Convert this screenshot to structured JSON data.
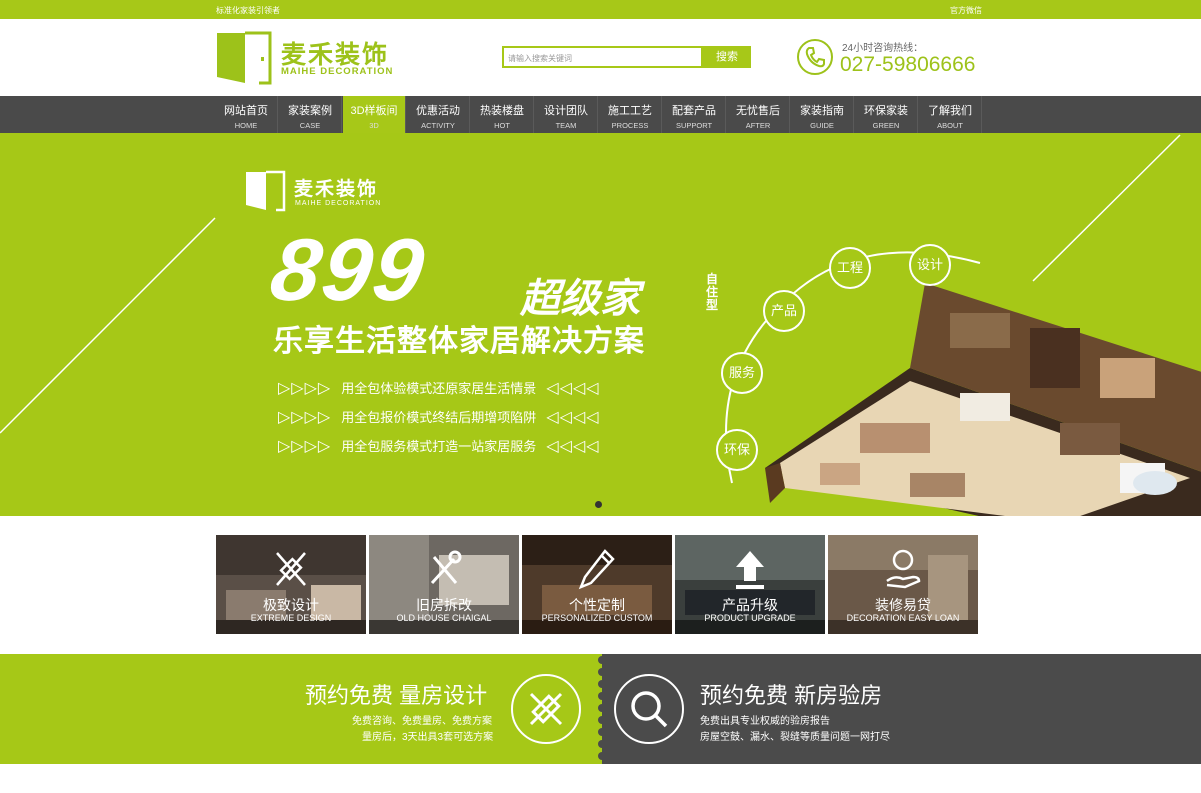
{
  "topbar": {
    "left": "标准化家装引领者",
    "right": "官方微信"
  },
  "header": {
    "logo_cn": "麦禾装饰",
    "logo_en": "MAIHE DECORATION",
    "search_placeholder": "请输入搜索关键词",
    "search_button": "搜索",
    "hotline_label": "24小时咨询热线：",
    "hotline_number": "027-59806666"
  },
  "nav": [
    {
      "cn": "网站首页",
      "en": "HOME"
    },
    {
      "cn": "家装案例",
      "en": "CASE"
    },
    {
      "cn": "3D样板间",
      "en": "3D"
    },
    {
      "cn": "优惠活动",
      "en": "ACTIVITY"
    },
    {
      "cn": "热装楼盘",
      "en": "HOT"
    },
    {
      "cn": "设计团队",
      "en": "TEAM"
    },
    {
      "cn": "施工工艺",
      "en": "PROCESS"
    },
    {
      "cn": "配套产品",
      "en": "SUPPORT"
    },
    {
      "cn": "无忧售后",
      "en": "AFTER"
    },
    {
      "cn": "家装指南",
      "en": "GUIDE"
    },
    {
      "cn": "环保家装",
      "en": "GREEN"
    },
    {
      "cn": "了解我们",
      "en": "ABOUT"
    }
  ],
  "banner": {
    "logo_cn": "麦禾装饰",
    "logo_en": "MAIHE DECORATION",
    "price": "899",
    "headline": "超级家",
    "side": "自住型",
    "subtitle": "乐享生活整体家居解决方案",
    "arrows_right": "▷▷▷▷",
    "arrows_left": "◁◁◁◁",
    "features": [
      "用全包体验模式还原家居生活情景",
      "用全包报价模式终结后期增项陷阱",
      "用全包服务模式打造一站家居服务"
    ],
    "tags": [
      "工程",
      "设计",
      "产品",
      "服务",
      "环保"
    ]
  },
  "services": [
    {
      "cn": "极致设计",
      "en": "EXTREME DESIGN",
      "icon": "pencil-ruler-icon"
    },
    {
      "cn": "旧房拆改",
      "en": "OLD HOUSE CHAIGAL",
      "icon": "tools-icon"
    },
    {
      "cn": "个性定制",
      "en": "PERSONALIZED CUSTOM",
      "icon": "pencil-icon"
    },
    {
      "cn": "产品升级",
      "en": "PRODUCT UPGRADE",
      "icon": "upload-icon"
    },
    {
      "cn": "装修易贷",
      "en": "DECORATION EASY LOAN",
      "icon": "yen-hand-icon"
    }
  ],
  "promo": {
    "left_title": "预约免费  量房设计",
    "left_line1": "免费咨询、免费量房、免费方案",
    "left_line2": "量房后，3天出具3套可选方案",
    "right_title": "预约免费  新房验房",
    "right_line1": "免费出具专业权威的验房报告",
    "right_line2": "房屋空鼓、漏水、裂缝等质量问题一网打尽"
  },
  "colors": {
    "brand": "#a7c818",
    "nav_bg": "#4a4a4a",
    "dark_panel": "#4b4b4b"
  }
}
